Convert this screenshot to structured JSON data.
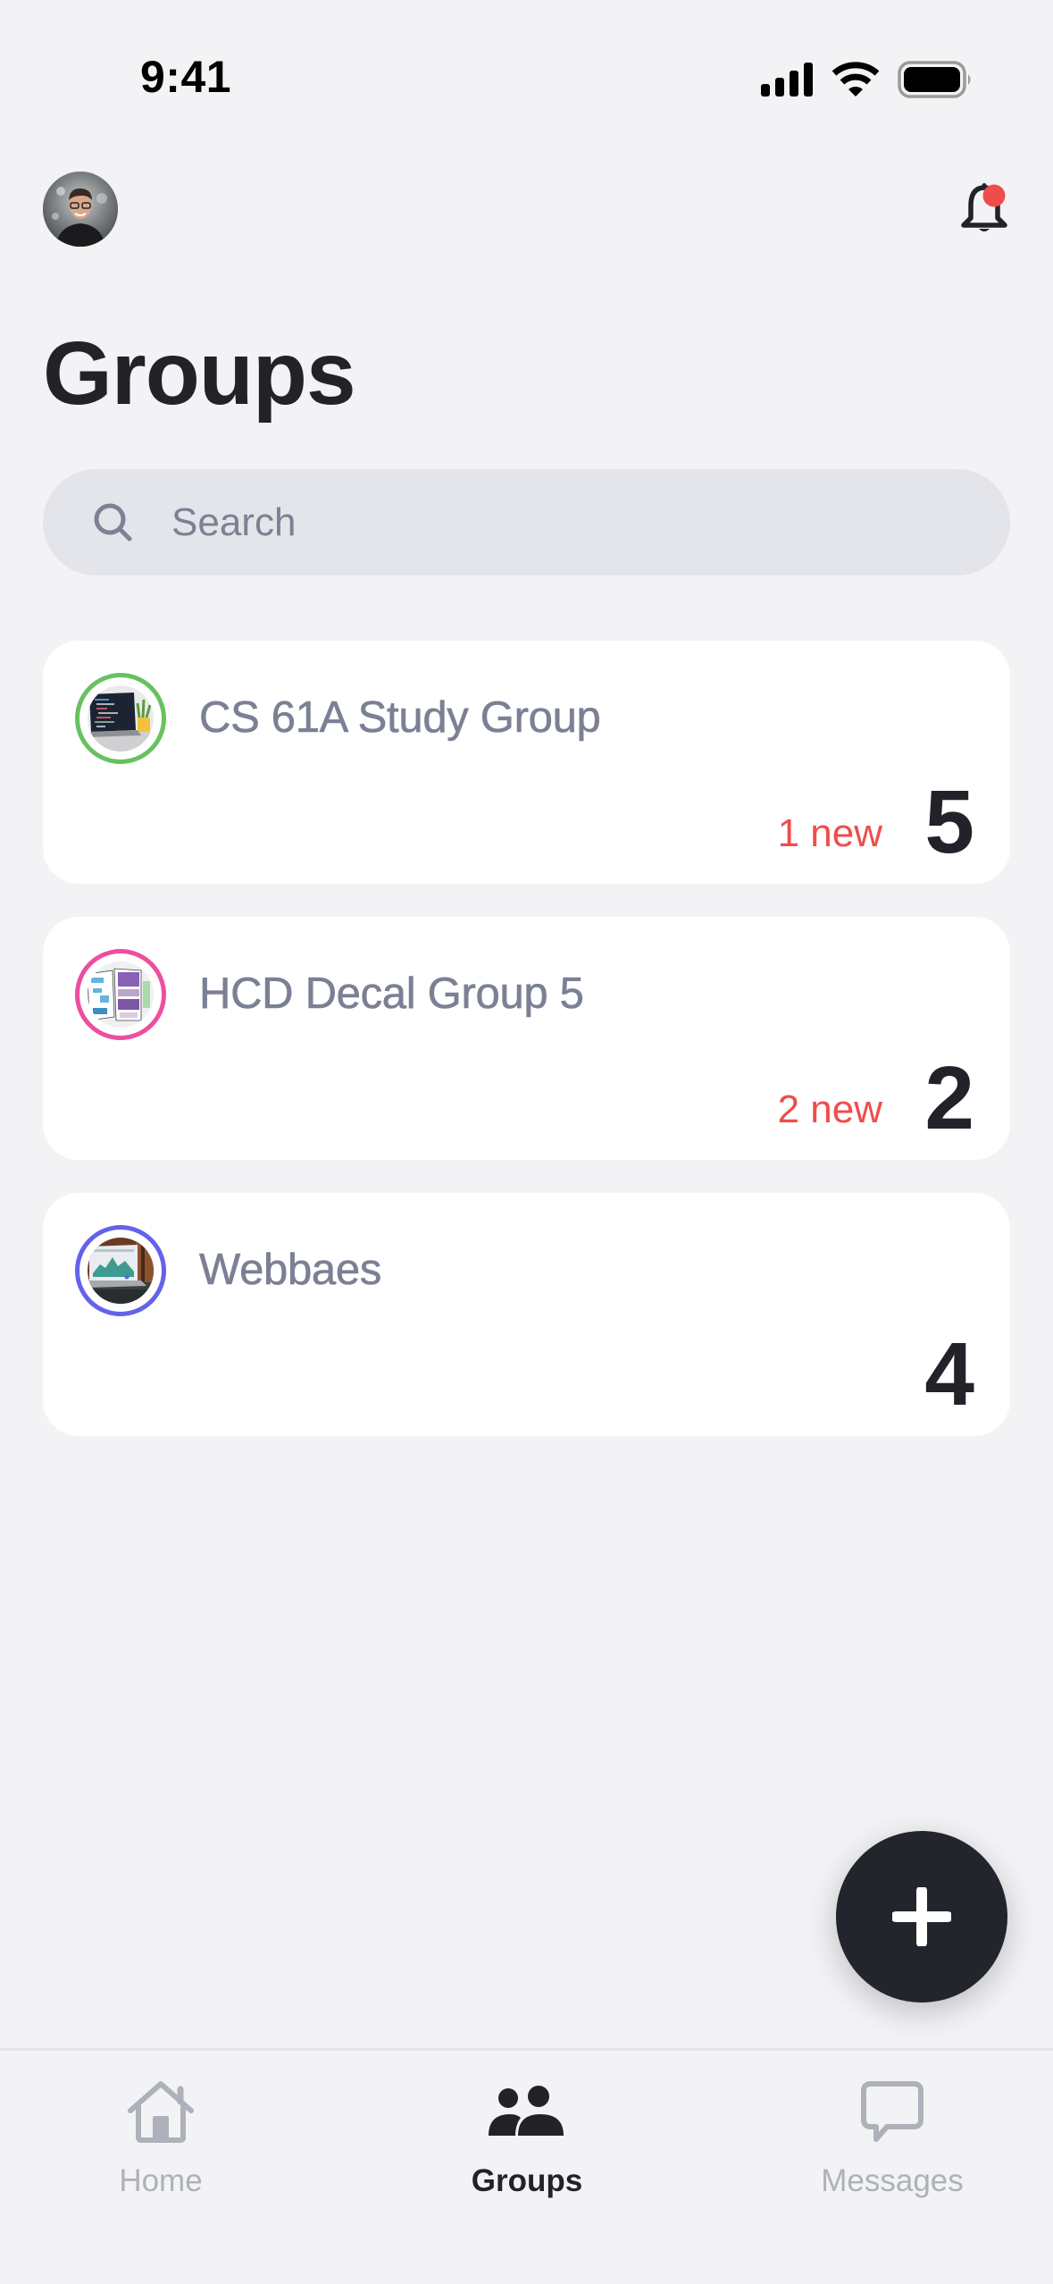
{
  "status_bar": {
    "time": "9:41",
    "icons": [
      "cellular-signal-icon",
      "wifi-icon",
      "battery-icon"
    ]
  },
  "header": {
    "avatar_alt": "User profile photo",
    "notification_icon": "bell-icon",
    "has_unread_notification": true
  },
  "page": {
    "title": "Groups"
  },
  "search": {
    "placeholder": "Search",
    "value": ""
  },
  "groups": [
    {
      "name": "CS 61A Study Group",
      "new_label": "1 new",
      "count": "5",
      "ring_color": "#68c160",
      "thumbnail": "laptop-code-photo"
    },
    {
      "name": "HCD Decal Group 5",
      "new_label": "2 new",
      "count": "2",
      "ring_color": "#ec4fa0",
      "thumbnail": "wireframe-sketches-photo"
    },
    {
      "name": "Webbaes",
      "new_label": "",
      "count": "4",
      "ring_color": "#6462ea",
      "thumbnail": "laptop-dashboard-photo"
    }
  ],
  "fab": {
    "icon": "plus-icon",
    "label": "Create group"
  },
  "tabbar": {
    "tabs": [
      {
        "label": "Home",
        "icon": "home-icon",
        "active": false
      },
      {
        "label": "Groups",
        "icon": "groups-icon",
        "active": true
      },
      {
        "label": "Messages",
        "icon": "chat-bubble-icon",
        "active": false
      }
    ]
  },
  "colors": {
    "background": "#f3f3f6",
    "card": "#ffffff",
    "text_primary": "#212329",
    "text_secondary": "#7b8094",
    "new_badge": "#ef4d4d",
    "tab_inactive": "#adb1b9",
    "notification_dot": "#ef4d4d"
  }
}
